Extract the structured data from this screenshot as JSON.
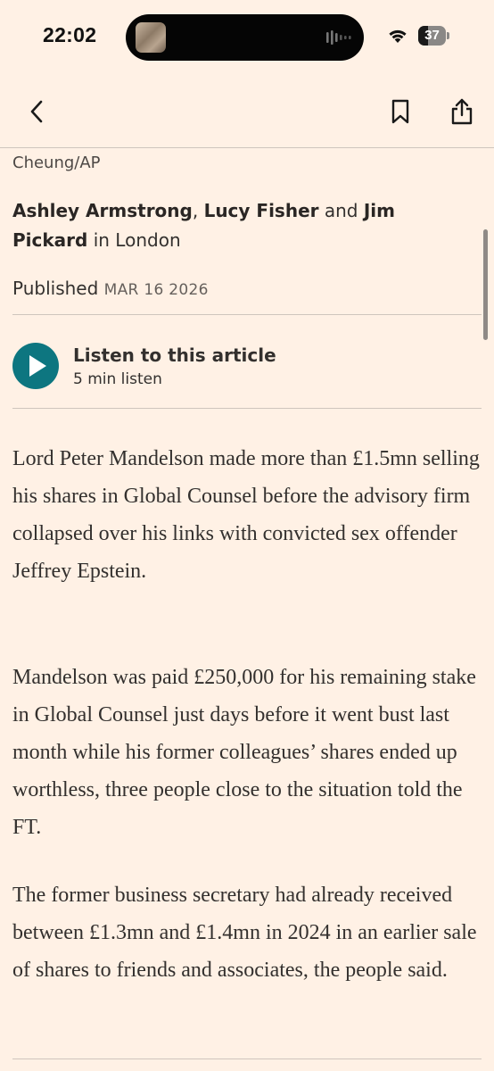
{
  "status_bar": {
    "time": "22:02",
    "battery": "37",
    "battery_level": 0.37
  },
  "nav": {
    "back_icon": "chevron-left-icon",
    "bookmark_icon": "bookmark-icon",
    "share_icon": "share-icon"
  },
  "article": {
    "image_credit": "Cheung/AP",
    "authors": [
      "Ashley Armstrong",
      "Lucy Fisher",
      "Jim Pickard"
    ],
    "byline_sep": ", ",
    "byline_and": " and ",
    "byline_location": " in London",
    "published_label": "Published",
    "published_date": "MAR 16 2026",
    "listen": {
      "title": "Listen to this article",
      "duration": "5 min listen"
    },
    "paragraphs": [
      "Lord Peter Mandelson made more than £1.5mn selling his shares in Global Counsel before the advisory firm collapsed over his links with convicted sex offender Jeffrey Epstein.",
      "Mandelson was paid £250,000 for his remaining stake in Global Counsel just days before it went bust last month while his former colleagues’ shares ended up worthless, three people close to the situation told the FT.",
      "The former business secretary had already received between £1.3mn and £1.4mn in 2024 in an earlier sale of shares to friends and associates, the people said."
    ]
  },
  "colors": {
    "background": "#fff1e5",
    "accent": "#0d7680",
    "text": "#33302e"
  }
}
